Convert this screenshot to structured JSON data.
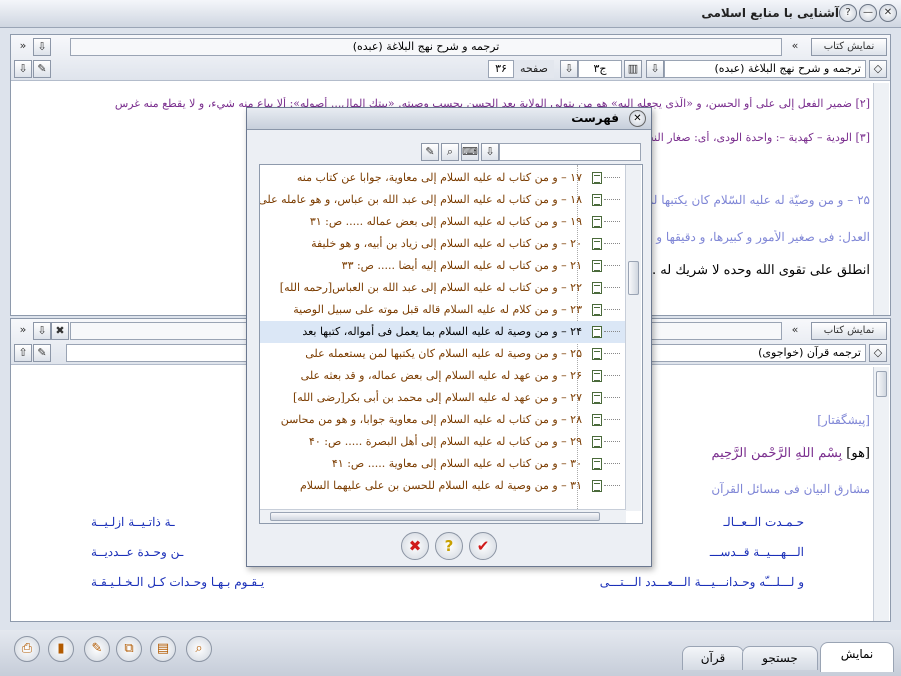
{
  "app": {
    "title": "آشنایی با منابع اسلامی"
  },
  "top_pane": {
    "show_book_label": "نمایش کتاب",
    "book_title": "ترجمه و شرح نهج البلاغة (عبده)",
    "book_select": "ترجمه و شرح نهج البلاغة (عبده)",
    "volume_value": "ج۳",
    "page_label": "صفحه",
    "page_value": "۳۶",
    "lines": [
      "[۲] ضمير الفعل إلى على أو الحسن، و «الّذى يجعله إليه» هو من يتولى الولاية بعد الحسن بحسب وصيته. «بيتك المال... أصوله»: ألا يباع منه شيء، و لا يقطع منه غرس",
      "[۳] الودية – كهدية –: واحدة الودى، أى: صغار النخل... حتى تنبت الأرض فقلع فسيلها يضر بها.",
      "۲۵ – و من وصيّة له عليه السّلام كان يكتبها لمن يستعمله على الصدقات، ... أنه كان يقيم عماد الحق، و يشرع أمثلة",
      "العدل: فى صغير الأمور و كبيرها، و دقيقها و جليلها",
      "انطلق على تقوى اللّه وحده لا شريك له ... أكثر من حقّ اللّه فى ماله، فإذا قدمت على"
    ]
  },
  "bottom_pane": {
    "show_book_label": "نمایش کتاب",
    "book_select": "ترجمه قرآن (خواجوى)",
    "preface": "[پیشگفتار]",
    "bismillah_tag": "[هو]",
    "bismillah": "بِسْمِ اللّهِ الرَّحْمنِ الرَّحِيمِ",
    "subtitle": "مشارق البيان فى مسائل القرآن",
    "poem": [
      {
        "right": "حـمـدت الــعــالـ",
        "left": "ـة ذاتـيــة ازلـيــة"
      },
      {
        "right": "الـــهـــيــة قــدســـ",
        "left": "ـن وحـدة عــدديــة"
      },
      {
        "right": "و لـــلـــّه وحـدانـــيـــة الـــعـــدد الـــتـــى",
        "left": "يـقـوم بـهـا وحـدات كـل الـخـلـيـقـة"
      }
    ]
  },
  "dialog": {
    "title": "فهرست",
    "items": [
      "۱۷ – و من كتاب له عليه السلام إلى معاوية، جوابا عن كتاب منه",
      "۱۸ – و من كتاب له عليه السلام إلى عبد الله بن عباس، و هو عامله على البصرة",
      "۱۹ – و من كتاب له عليه السلام إلى بعض عماله ..... ص: ۳۱",
      "۲۰ – و من كتاب له عليه السلام إلى زياد بن أبيه، و هو خليفة",
      "۲۱ – و من كتاب له عليه السلام إليه أيضا ..... ص: ۳۳",
      "۲۲ – و من كتاب له عليه السلام إلى عبد الله بن العباس[رحمه الله]",
      "۲۳ – و من كلام له عليه السلام قاله قبل موته على سبيل الوصية",
      "۲۴ – و من وصية له عليه السلام بما يعمل فى أمواله، كتبها بعد",
      "۲۵ – و من وصية له عليه السلام كان يكتبها لمن يستعمله على",
      "۲۶ – و من عهد له عليه السلام إلى بعض عماله، و قد بعثه على",
      "۲۷ – و من عهد له عليه السلام إلى محمد بن أبى بكر[رضى الله]",
      "۲۸ – و من كتاب له عليه السلام إلى معاوية جوابا، و هو من محاسن",
      "۲۹ – و من كتاب له عليه السلام إلى أهل البصرة ..... ص: ۴۰",
      "۳۰ – و من كتاب له عليه السلام إلى معاوية ..... ص: ۴۱",
      "۳۱ – و من وصية له عليه السلام للحسن بن على عليهما السلام"
    ],
    "selected_index": 7
  },
  "tabs": [
    "نمایش",
    "جستجو",
    "قرآن"
  ],
  "colors": {
    "accent_purple": "#7a2e8e",
    "blue_text": "#7f86d6",
    "list_text": "#7b3c00"
  }
}
